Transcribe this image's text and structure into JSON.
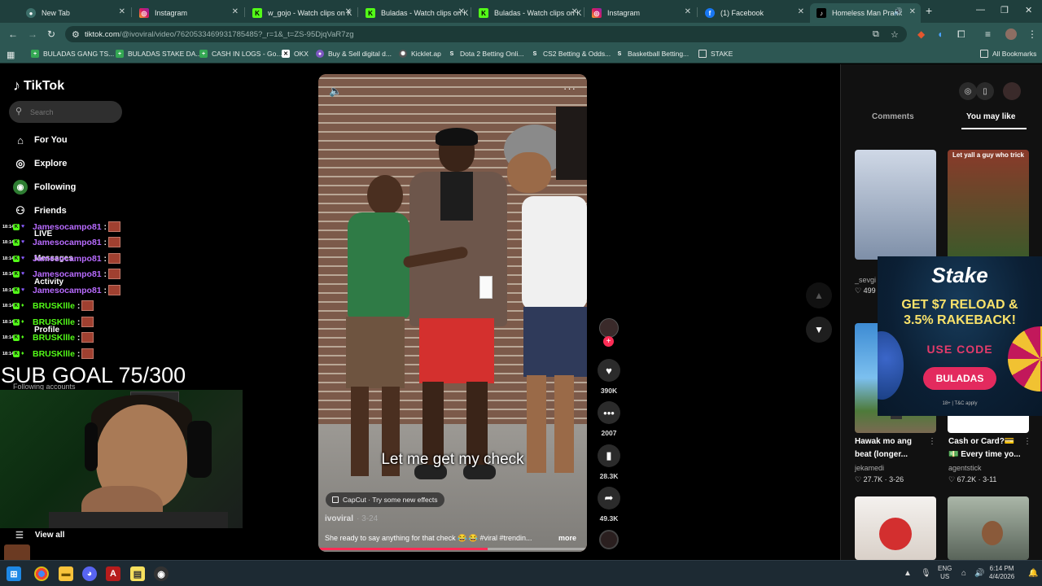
{
  "browser": {
    "tabs": [
      {
        "title": "New Tab",
        "icon": "chrome-icon",
        "active": false
      },
      {
        "title": "Instagram",
        "icon": "instagram-icon",
        "active": false
      },
      {
        "title": "w_gojo - Watch clips on K",
        "icon": "kick-icon",
        "active": false
      },
      {
        "title": "Buladas - Watch clips on K",
        "icon": "kick-icon",
        "active": false
      },
      {
        "title": "Buladas - Watch clips on K",
        "icon": "kick-icon",
        "active": false
      },
      {
        "title": "Instagram",
        "icon": "instagram-icon",
        "active": false
      },
      {
        "title": "(1) Facebook",
        "icon": "facebook-icon",
        "active": false
      },
      {
        "title": "Homeless Man Prank",
        "icon": "tiktok-icon",
        "active": true
      }
    ],
    "url_main": "tiktok.com",
    "url_rest": "/@ivoviral/video/7620533469931785485?_r=1&_t=ZS-95DjqVaR7zg",
    "bookmarks": [
      "BULADAS GANG TS...",
      "BULADAS STAKE DA...",
      "CASH IN LOGS - Go...",
      "OKX",
      "Buy & Sell digital d...",
      "Kicklet.ap",
      "Dota 2 Betting Onli...",
      "CS2 Betting & Odds...",
      "Basketball Betting...",
      "STAKE"
    ],
    "all_bookmarks": "All Bookmarks"
  },
  "tiktok": {
    "logo": "TikTok",
    "search_placeholder": "Search",
    "nav": {
      "for_you": "For You",
      "explore": "Explore",
      "following": "Following",
      "friends": "Friends",
      "live": "LIVE",
      "messages": "Messages",
      "activity": "Activity",
      "profile": "Profile",
      "following_accounts": "Following accounts",
      "view_all": "View all"
    },
    "video": {
      "caption": "Let me get my check",
      "capcut": "CapCut · Try some new effects",
      "author": "ivoviral",
      "date": "3-24",
      "description": "She ready to say anything for that check 😂 😂 #viral #trendin...",
      "more": "more",
      "progress": 0.63
    },
    "actions": {
      "likes": "390K",
      "comments": "2007",
      "saves": "28.3K",
      "shares": "49.3K"
    },
    "panel": {
      "tab_comments": "Comments",
      "tab_you_may_like": "You may like",
      "videos": [
        {
          "title": "_sevgi",
          "user": "",
          "stats": "499"
        },
        {
          "title": "Hawak mo ang",
          "title2": "beat (longer...",
          "user": "jekamedi",
          "stats": "27.7K · 3-26"
        },
        {
          "title": "Cash or Card?💳",
          "title2": "💵 Every time yo...",
          "user": "agentstick",
          "stats": "67.2K · 3-11"
        }
      ],
      "thumb_text": "Let yall a guy who trick"
    }
  },
  "overlay": {
    "chat": [
      {
        "time": "18:14",
        "user": "Jamesocampo81",
        "color": "#b86bff"
      },
      {
        "time": "18:14",
        "user": "Jamesocampo81",
        "color": "#b86bff"
      },
      {
        "time": "18:14",
        "user": "Jamesocampo81",
        "color": "#b86bff"
      },
      {
        "time": "18:14",
        "user": "Jamesocampo81",
        "color": "#b86bff"
      },
      {
        "time": "18:14",
        "user": "Jamesocampo81",
        "color": "#b86bff"
      },
      {
        "time": "18:14",
        "user": "BRUSKllle",
        "color": "#53fc18"
      },
      {
        "time": "18:14",
        "user": "BRUSKllle",
        "color": "#53fc18"
      },
      {
        "time": "18:14",
        "user": "BRUSKllle",
        "color": "#53fc18"
      },
      {
        "time": "18:14",
        "user": "BRUSKllle",
        "color": "#53fc18"
      }
    ],
    "sub_goal": "SUB GOAL 75/300"
  },
  "ad": {
    "brand": "Stake",
    "headline1": "GET $7 RELOAD &",
    "headline2": "3.5% RAKEBACK!",
    "use_code": "USE CODE",
    "code": "BULADAS",
    "terms": "18+ | T&C apply"
  },
  "taskbar": {
    "lang1": "ENG",
    "lang2": "US",
    "time": "6:14 PM",
    "date": "4/4/2026"
  }
}
